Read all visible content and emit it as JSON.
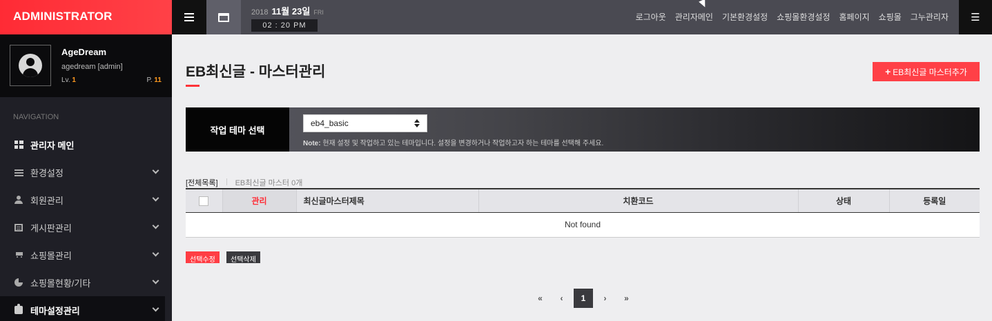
{
  "app": {
    "brand": "ADMINISTRATOR"
  },
  "header": {
    "year": "2018",
    "month_day": "11월 23일",
    "weekday": "FRI",
    "time": "02 : 20 PM",
    "links": [
      "로그아웃",
      "관리자메인",
      "기본환경설정",
      "쇼핑몰환경설정",
      "홈페이지",
      "쇼핑몰",
      "그누관리자"
    ]
  },
  "profile": {
    "name": "AgeDream",
    "id": "agedream [admin]",
    "level_label": "Lv.",
    "level": "1",
    "point_label": "P.",
    "point": "11"
  },
  "sidebar": {
    "nav_title": "NAVIGATION",
    "items": [
      {
        "label": "관리자 메인",
        "icon": "grid-icon"
      },
      {
        "label": "환경설정",
        "icon": "sliders-icon"
      },
      {
        "label": "회원관리",
        "icon": "user-icon"
      },
      {
        "label": "게시판관리",
        "icon": "list-icon"
      },
      {
        "label": "쇼핑몰관리",
        "icon": "cart-icon"
      },
      {
        "label": "쇼핑몰현황/기타",
        "icon": "pie-chart-icon"
      },
      {
        "label": "테마설정관리",
        "icon": "puzzle-icon"
      }
    ]
  },
  "main": {
    "title": "EB최신글 - 마스터관리",
    "add_button": "EB최신글 마스터추가",
    "theme": {
      "label": "작업 테마 선택",
      "selected": "eb4_basic",
      "note_label": "Note:",
      "note": "현재 설정 및 작업하고 있는 테마입니다. 설정을 변경하거나 작업하고자 하는 테마를 선택해 주세요."
    },
    "list_info": {
      "all": "[전체목록]",
      "count": "EB최신글 마스터 0개"
    },
    "table": {
      "headers": [
        "관리",
        "최신글마스터제목",
        "치환코드",
        "상태",
        "등록일"
      ],
      "empty": "Not found"
    },
    "actions": {
      "edit": "선택수정",
      "delete": "선택삭제"
    },
    "pager": {
      "first": "«",
      "prev": "‹",
      "current": "1",
      "next": "›",
      "last": "»"
    }
  }
}
